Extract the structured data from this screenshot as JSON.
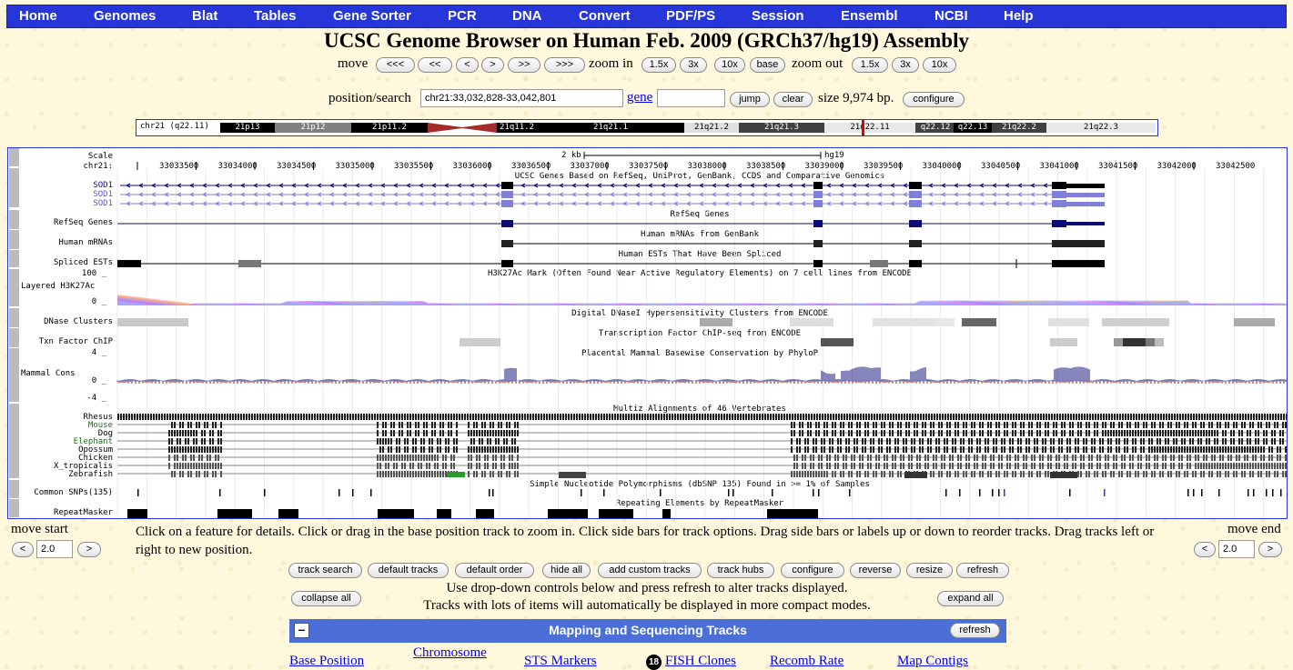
{
  "nav": [
    "Home",
    "Genomes",
    "Blat",
    "Tables",
    "Gene Sorter",
    "PCR",
    "DNA",
    "Convert",
    "PDF/PS",
    "Session",
    "Ensembl",
    "NCBI",
    "Help"
  ],
  "title": "UCSC Genome Browser on Human Feb. 2009 (GRCh37/hg19) Assembly",
  "move": {
    "label": "move",
    "buttons": [
      "<<<",
      "<<",
      "<",
      ">",
      ">>",
      ">>>"
    ]
  },
  "zoom_in": {
    "label": "zoom in",
    "buttons": [
      "1.5x",
      "3x",
      "10x",
      "base"
    ]
  },
  "zoom_out": {
    "label": "zoom out",
    "buttons": [
      "1.5x",
      "3x",
      "10x"
    ]
  },
  "search": {
    "label": "position/search",
    "value": "chr21:33,032,828-33,042,801",
    "gene_link": "gene",
    "gene_value": "",
    "jump": "jump",
    "clear": "clear",
    "size": "size 9,974 bp.",
    "configure": "configure"
  },
  "ideogram": {
    "chrom": "chr21 (q22.11)",
    "bands": [
      {
        "name": "21p13",
        "color": "#000000",
        "text": "#ffffff"
      },
      {
        "name": "21p12",
        "color": "#808080",
        "text": "#ffffff"
      },
      {
        "name": "21p11.2",
        "color": "#000000",
        "text": "#ffffff"
      },
      {
        "name": "",
        "color": "#a52a2a",
        "text": "#ffffff"
      },
      {
        "name": "21q11.2",
        "color": "#000000",
        "text": "#ffffff"
      },
      {
        "name": "21q21.1",
        "color": "#000000",
        "text": "#ffffff"
      },
      {
        "name": "21q21.2",
        "color": "#e0e0e0",
        "text": "#000000"
      },
      {
        "name": "21q21.3",
        "color": "#404040",
        "text": "#ffffff"
      },
      {
        "name": "21q22.11",
        "color": "#e8e8e8",
        "text": "#000000"
      },
      {
        "name": "q22.12",
        "color": "#404040",
        "text": "#ffffff"
      },
      {
        "name": "q22.13",
        "color": "#000000",
        "text": "#ffffff"
      },
      {
        "name": "21q22.2",
        "color": "#404040",
        "text": "#ffffff"
      },
      {
        "name": "21q22.3",
        "color": "#e8e8e8",
        "text": "#000000"
      }
    ]
  },
  "tracks": {
    "scale_label": "Scale",
    "chr_label": "chr21:",
    "scale_bar": "2 kb",
    "assembly": "hg19",
    "ticks": [
      "33033500",
      "33034000",
      "33034500",
      "33035000",
      "33035500",
      "33036000",
      "33036500",
      "33037000",
      "33037500",
      "33038000",
      "33038500",
      "33039000",
      "33039500",
      "33040000",
      "33040500",
      "33041000",
      "33041500",
      "33042000",
      "33042500"
    ],
    "ucsc_title": "UCSC Genes Based on RefSeq, UniProt, GenBank, CCDS and Comparative Genomics",
    "sod": [
      "SOD1",
      "SOD1",
      "SOD1"
    ],
    "refseq_label": "RefSeq Genes",
    "refseq_title": "RefSeq Genes",
    "mrna_label": "Human mRNAs",
    "mrna_title": "Human mRNAs from GenBank",
    "est_label": "Spliced ESTs",
    "est_title": "Human ESTs That Have Been Spliced",
    "h3k_max": "100 _",
    "h3k_label": "Layered H3K27Ac",
    "h3k_min": "0 _",
    "h3k_title": "H3K27Ac Mark (Often Found Near Active Regulatory Elements) on 7 cell lines from ENCODE",
    "dnase_label": "DNase Clusters",
    "dnase_title": "Digital DNaseI Hypersensitivity Clusters from ENCODE",
    "txn_label": "Txn Factor ChIP",
    "txn_title": "Transcription Factor ChIP-seq from ENCODE",
    "cons_max": "4 _",
    "cons_label": "Mammal Cons",
    "cons_zero": "0 _",
    "cons_min": "-4 _",
    "cons_title": "Placental Mammal Basewise Conservation by PhyloP",
    "multiz_title": "Multiz Alignments of 46 Vertebrates",
    "species": [
      "Rhesus",
      "Mouse",
      "Dog",
      "Elephant",
      "Opossum",
      "Chicken",
      "X_tropicalis",
      "Zebrafish"
    ],
    "snp_label": "Common SNPs(135)",
    "snp_title": "Simple Nucleotide Polymorphisms (dbSNP 135) Found in >= 1% of Samples",
    "rmsk_title": "Repeating Elements by RepeatMasker",
    "rmsk_label": "RepeatMasker"
  },
  "colors": {
    "nav": "#2636d9",
    "gene": "#0c0c78",
    "ucsc_gene": "#8080d8",
    "section": "#4b6fd6"
  },
  "move_start": {
    "label": "move start",
    "value": "2.0",
    "left": "<",
    "right": ">"
  },
  "move_end": {
    "label": "move end",
    "value": "2.0",
    "left": "<",
    "right": ">"
  },
  "help_text": "Click on a feature for details. Click or drag in the base position track to zoom in. Click side bars for track options. Drag side bars or labels up or down to reorder tracks. Drag tracks left or right to new position.",
  "controls": [
    "track search",
    "default tracks",
    "default order",
    "hide all",
    "add custom tracks",
    "track hubs",
    "configure",
    "reverse",
    "resize",
    "refresh"
  ],
  "collapse_all": "collapse all",
  "expand_all": "expand all",
  "dropdown_note1": "Use drop-down controls below and press refresh to alter tracks displayed.",
  "dropdown_note2": "Tracks with lots of items will automatically be displayed in more compact modes.",
  "mapping": {
    "minus": "–",
    "title": "Mapping and Sequencing Tracks",
    "refresh": "refresh",
    "links": [
      "Base Position",
      "Chromosome",
      "STS Markers",
      "FISH Clones",
      "Recomb Rate",
      "Map Contigs"
    ],
    "fish_badge": "18"
  }
}
